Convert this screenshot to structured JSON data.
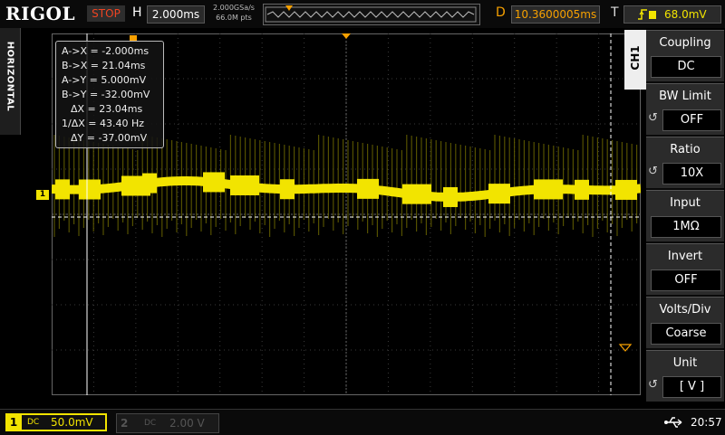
{
  "brand": "RIGOL",
  "header": {
    "run_state": "STOP",
    "h_label": "H",
    "timebase": "2.000ms",
    "sample_rate": "2.000GSa/s",
    "memory_depth": "66.0M pts",
    "d_label": "D",
    "trigger_position": "10.3600005ms",
    "t_label": "T",
    "trigger_source_icon": "rising-edge-icon",
    "trigger_level": "68.0mV"
  },
  "left_strip": {
    "label": "HORIZONTAL"
  },
  "cursor_readout": {
    "ax": "A->X = -2.000ms",
    "bx": "B->X = 21.04ms",
    "ay": "A->Y = 5.000mV",
    "by": "B->Y = -32.00mV",
    "dx": "ΔX = 23.04ms",
    "inv_dx": "1/ΔX = 43.40 Hz",
    "dy": "ΔY = -37.00mV"
  },
  "channel_marker": "1",
  "menu": {
    "channel_tab": "CH1",
    "items": [
      {
        "title": "Coupling",
        "value": "DC"
      },
      {
        "title": "BW Limit",
        "value": "OFF"
      },
      {
        "title": "Ratio",
        "value": "10X"
      },
      {
        "title": "Input",
        "value": "1MΩ"
      },
      {
        "title": "Invert",
        "value": "OFF"
      },
      {
        "title": "Volts/Div",
        "value": "Coarse"
      },
      {
        "title": "Unit",
        "value": "[  V  ]"
      }
    ]
  },
  "footer": {
    "ch1_number": "1",
    "ch1_coupling": "DC",
    "ch1_scale": "50.0mV",
    "ch2_number": "2",
    "ch2_coupling": "DC",
    "ch2_scale": "2.00 V",
    "clock": "20:57"
  },
  "colors": {
    "ch1": "#f2e400",
    "trigger": "#f6a000",
    "stop": "#e44422",
    "grid": "#3a3a3a"
  }
}
